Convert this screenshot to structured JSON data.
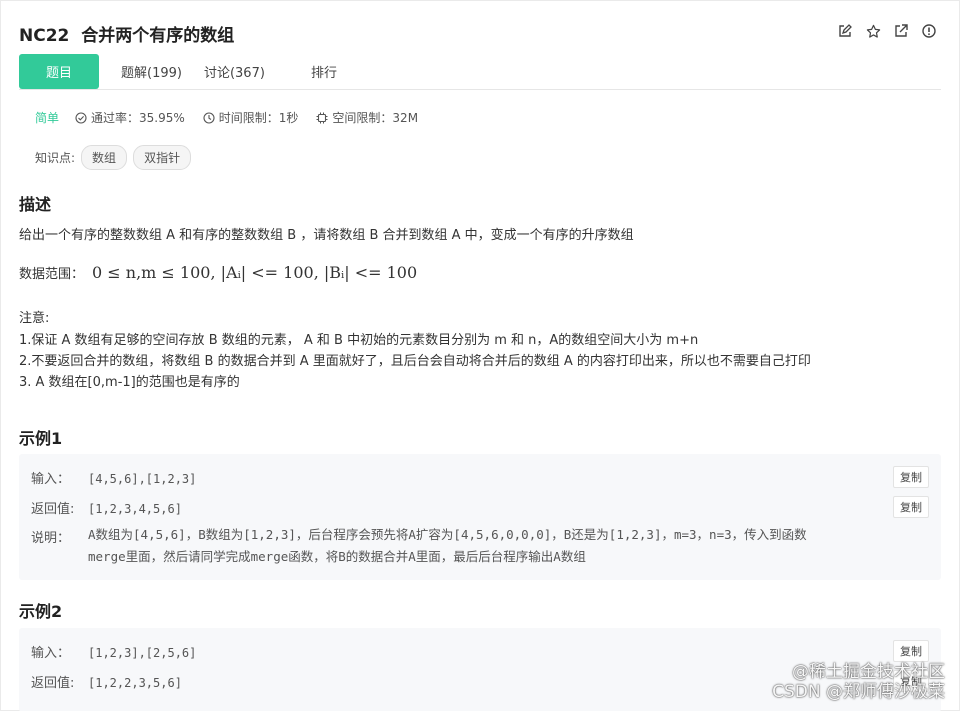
{
  "problem": {
    "title": "NC22  合并两个有序的数组"
  },
  "tabs": [
    {
      "label": "题目"
    },
    {
      "label": "题解(199)"
    },
    {
      "label": "讨论(367)"
    },
    {
      "label": "排行"
    }
  ],
  "meta": {
    "difficulty": "简单",
    "pass_rate": "通过率：35.95%",
    "time_limit": "时间限制：1秒",
    "space_limit": "空间限制：32M"
  },
  "knowledge": {
    "label": "知识点:",
    "tags": [
      "数组",
      "双指针"
    ]
  },
  "description": {
    "heading": "描述",
    "text": "给出一个有序的整数数组 A 和有序的整数数组 B ，请将数组 B 合并到数组 A 中，变成一个有序的升序数组",
    "range_label": "数据范围：",
    "range_math": "0 ≤ n,m ≤ 100,  |Aᵢ| <= 100,  |Bᵢ| <= 100",
    "note_title": "注意:",
    "notes": [
      "1.保证 A 数组有足够的空间存放 B 数组的元素， A 和 B 中初始的元素数目分别为 m 和 n，A的数组空间大小为 m+n",
      "2.不要返回合并的数组，将数组 B 的数据合并到 A 里面就好了，且后台会自动将合并后的数组 A 的内容打印出来，所以也不需要自己打印",
      "3. A 数组在[0,m-1]的范围也是有序的"
    ]
  },
  "examples": [
    {
      "heading": "示例1",
      "input_label": "输入：",
      "input": "[4,5,6],[1,2,3]",
      "output_label": "返回值:",
      "output": "[1,2,3,4,5,6]",
      "explain_label": "说明：",
      "explain_line1": "A数组为[4,5,6]，B数组为[1,2,3]，后台程序会预先将A扩容为[4,5,6,0,0,0]，B还是为[1,2,3]，m=3，n=3，传入到函数",
      "explain_line2": "merge里面，然后请同学完成merge函数，将B的数据合并A里面，最后后台程序输出A数组",
      "copy_label": "复制"
    },
    {
      "heading": "示例2",
      "input_label": "输入：",
      "input": "[1,2,3],[2,5,6]",
      "output_label": "返回值:",
      "output": "[1,2,2,3,5,6]",
      "copy_label": "复制"
    }
  ],
  "watermark": {
    "line1": "@稀土掘金技术社区",
    "line2": "CSDN @郑师傅沙极菜"
  },
  "colors": {
    "accent": "#32ca99"
  }
}
